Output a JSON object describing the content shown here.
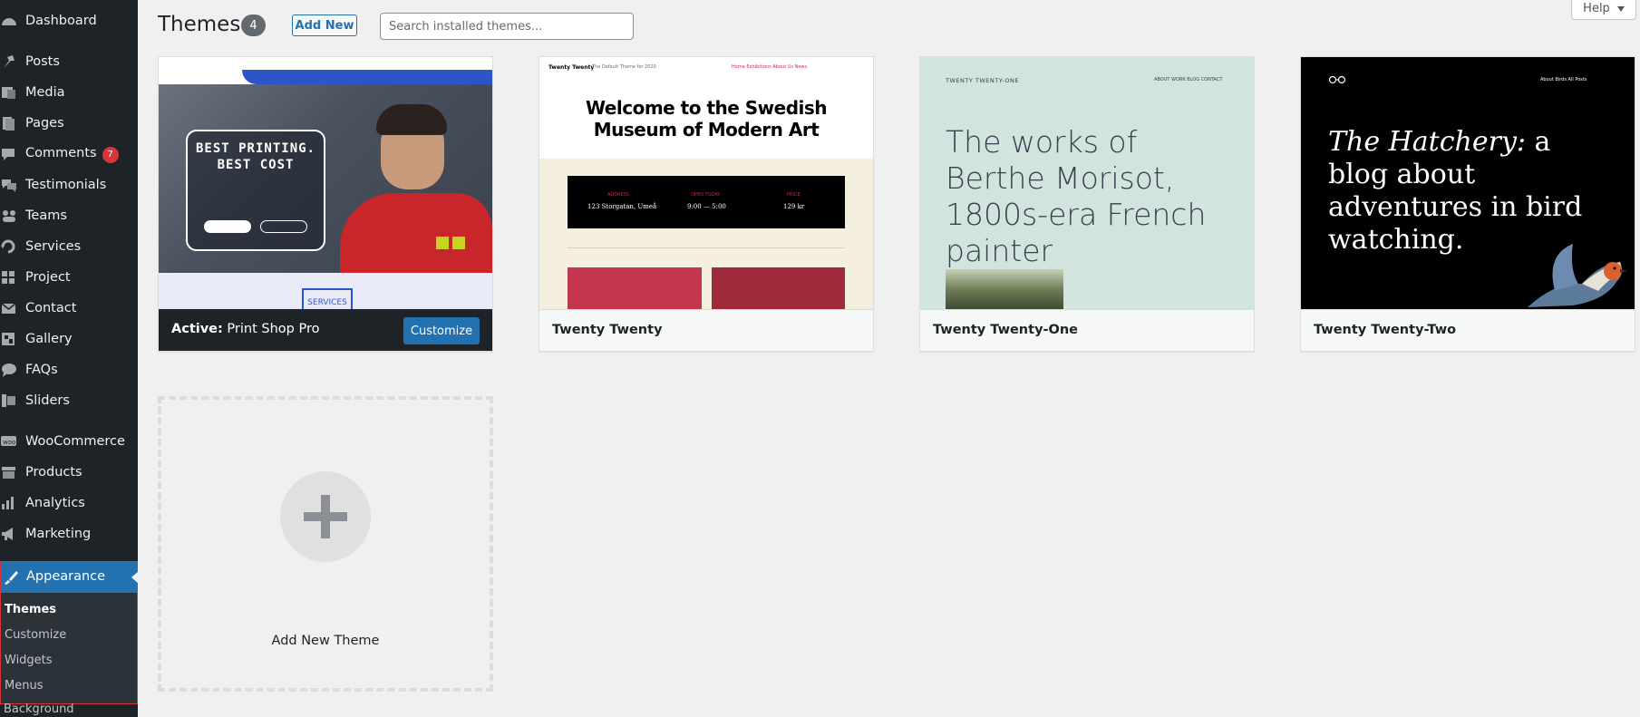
{
  "sidebar": {
    "items": [
      {
        "label": "Dashboard",
        "icon": "dashboard-icon"
      },
      {
        "label": "Posts",
        "icon": "pin-icon"
      },
      {
        "label": "Media",
        "icon": "media-icon"
      },
      {
        "label": "Pages",
        "icon": "page-icon"
      },
      {
        "label": "Comments",
        "icon": "comment-icon",
        "badge": "7"
      },
      {
        "label": "Testimonials",
        "icon": "testimonial-icon"
      },
      {
        "label": "Teams",
        "icon": "groups-icon"
      },
      {
        "label": "Services",
        "icon": "services-icon"
      },
      {
        "label": "Project",
        "icon": "portfolio-icon"
      },
      {
        "label": "Contact",
        "icon": "email-icon"
      },
      {
        "label": "Gallery",
        "icon": "gallery-icon"
      },
      {
        "label": "FAQs",
        "icon": "faq-icon"
      },
      {
        "label": "Sliders",
        "icon": "slides-icon"
      },
      {
        "label": "WooCommerce",
        "icon": "woocommerce-icon"
      },
      {
        "label": "Products",
        "icon": "archive-icon"
      },
      {
        "label": "Analytics",
        "icon": "chart-icon"
      },
      {
        "label": "Marketing",
        "icon": "megaphone-icon"
      }
    ],
    "appearance": {
      "label": "Appearance",
      "icon": "paintbrush-icon",
      "submenu": [
        "Themes",
        "Customize",
        "Widgets",
        "Menus"
      ],
      "current": "Themes"
    },
    "background_label": "Background"
  },
  "header": {
    "title": "Themes",
    "count": "4",
    "add_new_label": "Add New",
    "search_placeholder": "Search installed themes...",
    "help_label": "Help"
  },
  "themes": [
    {
      "name": "Print Shop Pro",
      "active_prefix": "Active:",
      "customize_label": "Customize",
      "shot": {
        "hero": "BEST PRINTING. BEST COST",
        "services": "SERVICES"
      }
    },
    {
      "name": "Twenty Twenty",
      "shot": {
        "logo": "Twenty Twenty",
        "tagline": "The Default Theme for 2020",
        "menu": "Home   Exhibitions   About Us   News",
        "title": "Welcome to the Swedish Museum of Modern Art",
        "cols": [
          {
            "head": "ADDRESS",
            "value": "123 Storgatan, Umeå"
          },
          {
            "head": "OPEN TODAY",
            "value": "9:00 — 5:00"
          },
          {
            "head": "PRICE",
            "value": "129 kr"
          }
        ]
      }
    },
    {
      "name": "Twenty Twenty-One",
      "shot": {
        "site": "TWENTY TWENTY-ONE",
        "nav": "ABOUT   WORK   BLOG   CONTACT",
        "title": "The works of Berthe Morisot, 1800s-era French painter"
      }
    },
    {
      "name": "Twenty Twenty-Two",
      "shot": {
        "nav": "About    Birds    All Posts",
        "title_italic": "The Hatchery:",
        "title_rest": " a blog about adventures in bird watching."
      }
    }
  ],
  "add_new_theme_label": "Add New Theme",
  "colors": {
    "sidebar_bg": "#1d2327",
    "accent": "#2271b1",
    "badge": "#d63638",
    "page_bg": "#f0f0f1"
  }
}
